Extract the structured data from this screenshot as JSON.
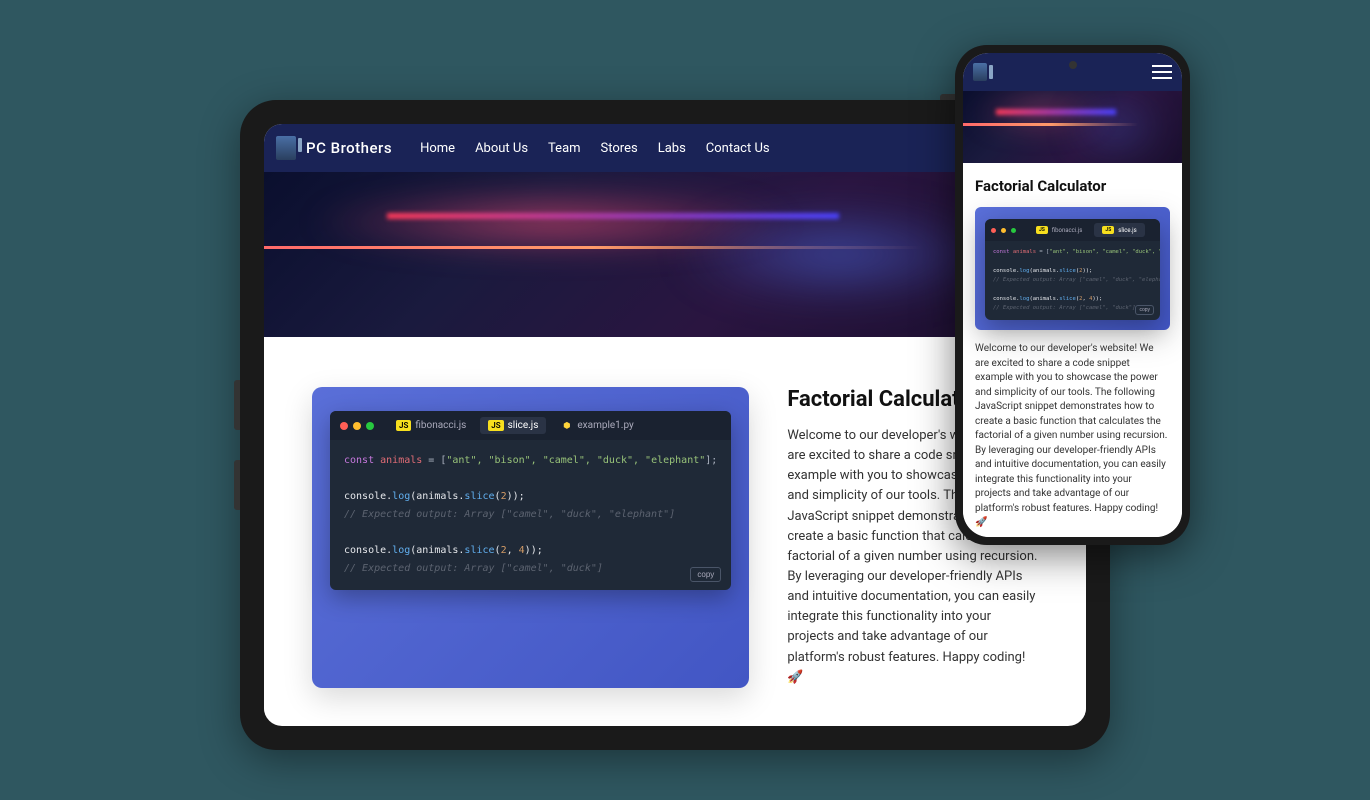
{
  "brand": "PC Brothers",
  "nav": {
    "home": "Home",
    "about": "About Us",
    "team": "Team",
    "stores": "Stores",
    "labs": "Labs",
    "contact": "Contact Us"
  },
  "article": {
    "title": "Factorial Calculator",
    "body": "Welcome to our developer's website! We are excited to share a code snippet example with you to showcase the power and simplicity of our tools. The following JavaScript snippet demonstrates how to create a basic function that calculates the factorial of a given number using recursion. By leveraging our developer-friendly APIs and intuitive documentation, you can easily integrate this functionality into your projects and take advantage of our platform's robust features. Happy coding! 🚀"
  },
  "code": {
    "tabs": {
      "fib": "fibonacci.js",
      "slice": "slice.js",
      "example": "example1.py"
    },
    "lines": {
      "l1_kw": "const",
      "l1_var": " animals",
      "l1_op": " = [",
      "l1_str": "\"ant\", \"bison\", \"camel\", \"duck\", \"elephant\"",
      "l1_end": "];",
      "l3_a": "console.",
      "l3_fn": "log",
      "l3_b": "(animals.",
      "l3_fn2": "slice",
      "l3_c": "(",
      "l3_num": "2",
      "l3_d": "));",
      "l4_comment": "// Expected output: Array [\"camel\", \"duck\", \"elephant\"]",
      "l6_a": "console.",
      "l6_fn": "log",
      "l6_b": "(animals.",
      "l6_fn2": "slice",
      "l6_c": "(",
      "l6_num1": "2",
      "l6_comma": ", ",
      "l6_num2": "4",
      "l6_d": "));",
      "l7_comment": "// Expected output: Array [\"camel\", \"duck\"]"
    },
    "copy": "copy"
  }
}
